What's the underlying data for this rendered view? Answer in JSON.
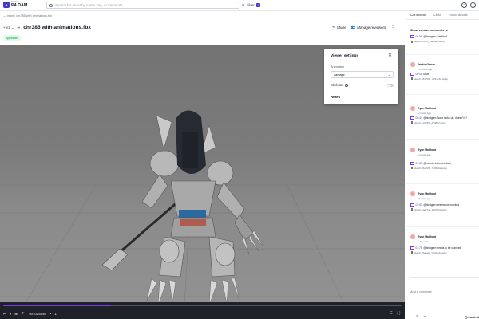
{
  "app": {
    "logo_small": "Perforce",
    "logo_main": "P4 DAM",
    "logo_mark": "P"
  },
  "search": {
    "placeholder": "Search for asset by name, tag, or metadata"
  },
  "filter": {
    "label": "Filter",
    "count": "1"
  },
  "breadcrumb": "← main / chr385 with animations.fbx",
  "asset": {
    "version": "v1",
    "title": "chr385 with animations.fbx",
    "status": "Approved",
    "share_label": "Share",
    "reviewers_label": "Manage reviewers"
  },
  "viewer_settings": {
    "title": "Viewer settings",
    "animation_label": "Animation",
    "animation_value": "damage",
    "skeleton_label": "Skeleton",
    "reset_label": "Reset"
  },
  "playback": {
    "time": "00:23/00:58",
    "progress": 0.27,
    "speed": "1"
  },
  "panel": {
    "tabs": [
      "Comments",
      "Links",
      "Asset details"
    ],
    "show_version": "Show version comments",
    "comments": [
      {
        "name": "",
        "time": "",
        "timestamp": "00:56",
        "text": "@bindgren i've fixed",
        "link": "sketch-5f6f20_2aff/a29.webp"
      },
      {
        "name": "Jackie Garcia",
        "time": "2 months ago",
        "timestamp": "00:01",
        "text": "cool!",
        "link": "sketch-c8370f8...8097e6d.webp"
      },
      {
        "name": "Ryan Mallhoot",
        "time": "a month ago",
        "timestamp": "00:44",
        "text": "@bindgren Bone looks off, doesn't it?",
        "link": "sketch-5c6768...d70882.webp"
      },
      {
        "name": "Ryan Mallhoot",
        "time": "a month ago",
        "timestamp": "01:53",
        "text": "@meedo to be cranked",
        "link": "sketch-ff4e205...7c3052a.webp"
      },
      {
        "name": "Ryan Mallhoot",
        "time": "14 days ago",
        "timestamp": "01:53",
        "text": "@bindgren seems not cranked",
        "link": "sketch-2ad77a...24f7f64f.webp"
      },
      {
        "name": "Ryan Mallhoot",
        "time": "a day ago",
        "timestamp": "01:76",
        "text": "@bindgren needs to be cranked",
        "link": "sketch-8baaeb...f4338e6.webp"
      }
    ],
    "comment_placeholder": "Add a comment",
    "look_label": "Look at"
  }
}
